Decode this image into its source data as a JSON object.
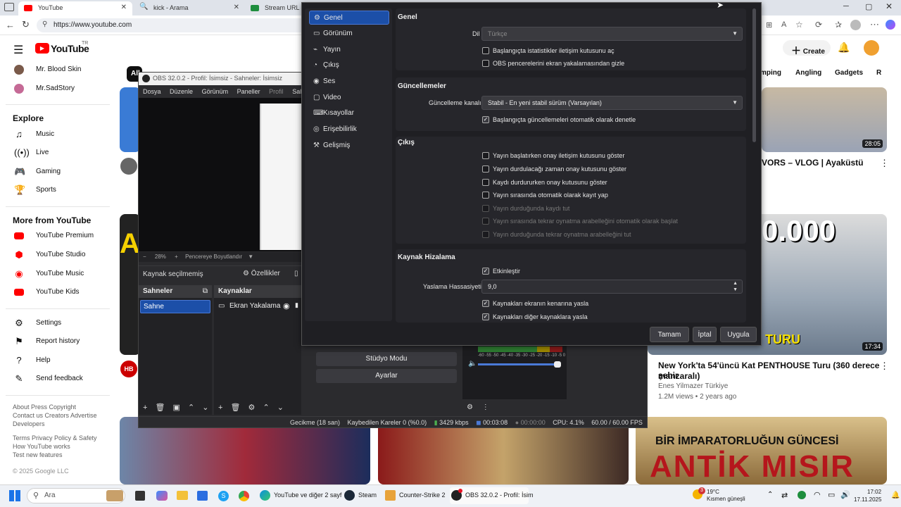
{
  "browser": {
    "tabs": [
      {
        "label": "YouTube",
        "active": true
      },
      {
        "label": "kick - Arama",
        "active": false
      },
      {
        "label": "Stream URL & K",
        "active": false
      }
    ],
    "url": "https://www.youtube.com"
  },
  "youtube": {
    "logo_text": "YouTube",
    "logo_sup": "TR",
    "create_label": "Create",
    "subscriptions": [
      "Mr. Blood Skin",
      "Mr.SadStory"
    ],
    "explore_title": "Explore",
    "explore_items": [
      "Music",
      "Live",
      "Gaming",
      "Sports"
    ],
    "more_title": "More from YouTube",
    "more_items": [
      "YouTube Premium",
      "YouTube Studio",
      "YouTube Music",
      "YouTube Kids"
    ],
    "settings_items": [
      "Settings",
      "Report history",
      "Help",
      "Send feedback"
    ],
    "footer_line1": "About  Press  Copyright",
    "footer_line2": "Contact us  Creators  Advertise",
    "footer_line3": "Developers",
    "footer_line4": "Terms  Privacy  Policy & Safety",
    "footer_line5": "How YouTube works",
    "footer_line6": "Test new features",
    "copyright": "© 2025 Google LLC",
    "chip_all": "All",
    "chips": [
      "mping",
      "Angling",
      "Gadgets",
      "R"
    ],
    "video1_title": "VORS – VLOG | Ayaküstü",
    "video1_duration": "28:05",
    "video2_big_text": "0.000",
    "video2_overlay": "TMAN TURU",
    "video2_duration": "17:34",
    "video2_title_1": "New York'ta 54'üncü Kat PENTHOUSE Turu (360 derece şehir",
    "video2_title_2": "manzaralı)",
    "video2_channel": "Enes Yilmazer Türkiye",
    "video2_meta": "1.2M views • 2 years ago",
    "bottom_thumb3_text_1": "BİR İMPARATORLUĞUN GÜNCESİ",
    "bottom_thumb3_text_2": "ANTİK MISIR",
    "hb_badge": "HB",
    "left_thumb_text": "A"
  },
  "obs": {
    "title": "OBS 32.0.2 - Profil: İsimsiz - Sahneler: İsimsiz",
    "menu": [
      "Dosya",
      "Düzenle",
      "Görünüm",
      "Paneller",
      "Profil",
      "Sahne"
    ],
    "zoom": "28%",
    "fit_label": "Pencereye Boyutlandır",
    "no_source": "Kaynak seçilmemiş",
    "properties": "Özellikler",
    "scenes_title": "Sahneler",
    "sources_title": "Kaynaklar",
    "scene_item": "Sahne",
    "source_item": "Ekran Yakalama",
    "studio_mode": "Stüdyo Modu",
    "settings_btn": "Ayarlar",
    "meter_scale": "-60 -55 -50 -45 -40 -35 -30 -25 -20 -15 -10 -5  0",
    "status": {
      "delay": "Gecikme (18 san)",
      "dropped": "Kaybedilen Kareler 0 (%0.0)",
      "bitrate": "3429 kbps",
      "stream_time": "00:03:08",
      "rec_time": "00:00:00",
      "cpu": "CPU: 4.1%",
      "fps": "60.00 / 60.00 FPS"
    }
  },
  "settings": {
    "nav": [
      "Genel",
      "Görünüm",
      "Yayın",
      "Çıkış",
      "Ses",
      "Video",
      "Kısayollar",
      "Erişebilirlik",
      "Gelişmiş"
    ],
    "nav_icons": [
      "⚙",
      "▭",
      "⌁",
      "◔",
      "◉",
      "▢",
      "⌨",
      "◎",
      "⚒"
    ],
    "genel": {
      "title": "Genel",
      "lang_label": "Dil",
      "lang_value": "Türkçe",
      "cb1": "Başlangıçta istatistikler iletişim kutusunu aç",
      "cb2": "OBS pencerelerini ekran yakalamasından gizle"
    },
    "updates": {
      "title": "Güncellemeler",
      "channel_label": "Güncelleme kanalı",
      "channel_value": "Stabil - En yeni stabil sürüm (Varsayılan)",
      "cb1": "Başlangıçta güncellemeleri otomatik olarak denetle"
    },
    "output": {
      "title": "Çıkış",
      "cb1": "Yayın başlatırken onay iletişim kutusunu göster",
      "cb2": "Yayın durdulacağı zaman onay kutusunu göster",
      "cb3": "Kaydı durdururken onay kutusunu göster",
      "cb4": "Yayın sırasında otomatik olarak kayıt yap",
      "cb5": "Yayın durduğunda kaydı tut",
      "cb6": "Yayın sırasında tekrar oynatma arabelleğini otomatik olarak başlat",
      "cb7": "Yayın durduğunda tekrar oynatma arabelleğini tut"
    },
    "snap": {
      "title": "Kaynak Hizalama",
      "cb1": "Etkinleştir",
      "sens_label": "Yaslama Hassasiyeti",
      "sens_value": "9,0",
      "cb2": "Kaynakları ekranın kenarına yasla",
      "cb3": "Kaynakları diğer kaynaklara yasla"
    },
    "buttons": {
      "ok": "Tamam",
      "cancel": "İptal",
      "apply": "Uygula"
    }
  },
  "taskbar": {
    "search": "Ara",
    "apps": [
      "YouTube ve diğer 2 sayf",
      "Steam",
      "Counter-Strike 2",
      "OBS 32.0.2 - Profil: İsim"
    ],
    "weather_temp": "19°C",
    "weather_desc": "Kısmen güneşli",
    "time": "17:02",
    "date": "17.11.2025",
    "badge": "3"
  }
}
